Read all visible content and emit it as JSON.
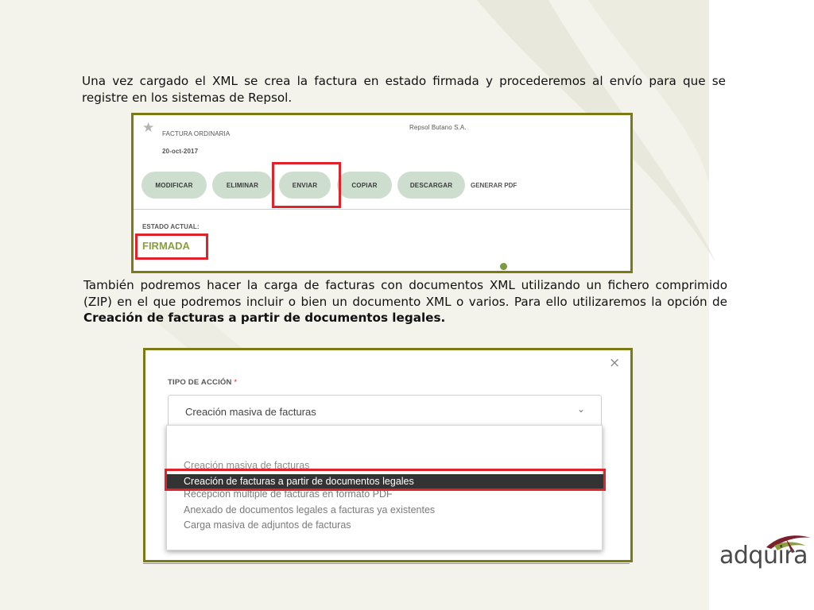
{
  "paragraphs": {
    "intro": "Una vez cargado el XML se crea la factura en estado firmada y procederemos al envío para que se registre en los sistemas de Repsol.",
    "zip_start": "También podremos hacer la carga de facturas con documentos XML utilizando un fichero comprimido (ZIP) en el que podremos incluir o bien un documento XML o varios. Para ello utilizaremos la opción de ",
    "zip_bold": "Creación de facturas a partir de documentos legales."
  },
  "invoice": {
    "type": "FACTURA ORDINARIA",
    "date": "20-oct-2017",
    "company": "Repsol Butano S.A.",
    "buttons": {
      "modificar": "MODIFICAR",
      "eliminar": "ELIMINAR",
      "enviar": "ENVIAR",
      "copiar": "COPIAR",
      "descargar": "DESCARGAR",
      "generar_pdf": "GENERAR PDF"
    },
    "status_label": "ESTADO ACTUAL:",
    "status_value": "FIRMADA"
  },
  "dialog": {
    "close": "×",
    "field_label": "TIPO DE ACCIÓN",
    "required_mark": "*",
    "selected": "Creación masiva de facturas",
    "options": [
      "Creación masiva de facturas",
      "Creación de facturas a partir de documentos legales",
      "Recepción múltiple de facturas en formato PDF",
      "Anexado de documentos legales a facturas ya existentes",
      "Carga masiva de adjuntos de facturas"
    ]
  },
  "logo": {
    "text": "adquira"
  },
  "colors": {
    "frame": "#7c7a14",
    "highlight": "#e0222a",
    "button": "#cddecf",
    "status": "#8aa03a",
    "selected_option": "#333333"
  },
  "icons": {
    "star": "star-icon",
    "close": "close-icon",
    "chevron": "chevron-down-icon"
  }
}
